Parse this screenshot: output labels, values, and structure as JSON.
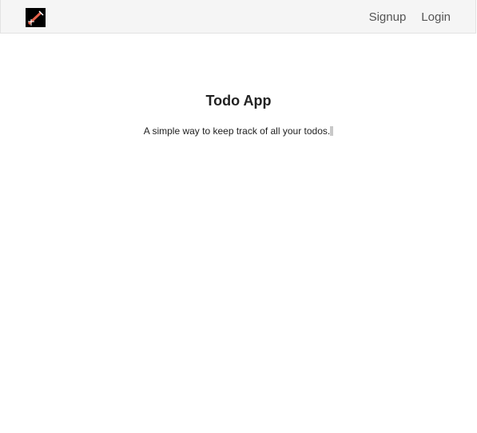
{
  "navbar": {
    "brand_icon": "pencil-logo-icon",
    "links": [
      {
        "label": "Signup"
      },
      {
        "label": "Login"
      }
    ]
  },
  "main": {
    "title": "Todo App",
    "subtitle": "A simple way to keep track of all your todos."
  },
  "colors": {
    "navbar_bg": "#f5f5f5",
    "brand_bg": "#000000",
    "text": "#222222",
    "link": "#555555"
  }
}
